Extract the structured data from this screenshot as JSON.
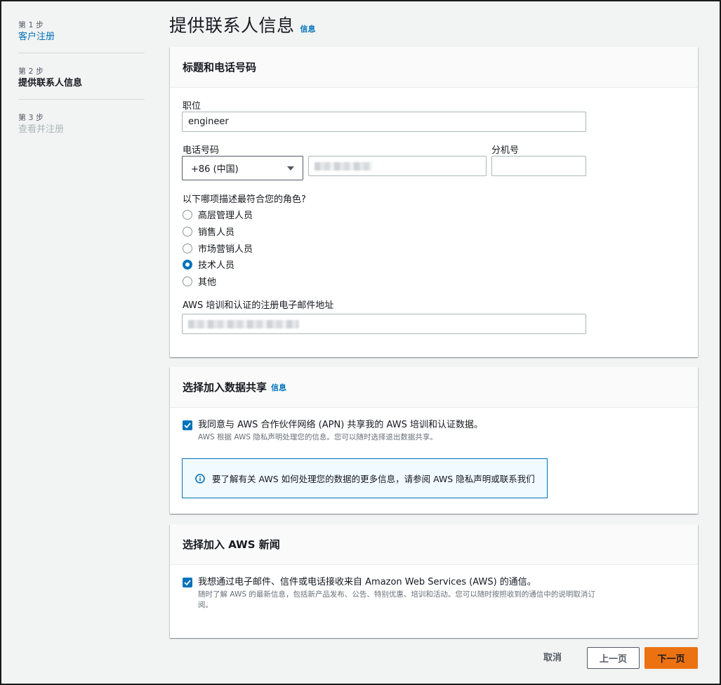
{
  "sidebar": {
    "steps": [
      {
        "number": "第 1 步",
        "label": "客户注册",
        "state": "link"
      },
      {
        "number": "第 2 步",
        "label": "提供联系人信息",
        "state": "active"
      },
      {
        "number": "第 3 步",
        "label": "查看并注册",
        "state": "disabled"
      }
    ]
  },
  "page": {
    "title": "提供联系人信息",
    "info_link": "信息"
  },
  "title_phone": {
    "header": "标题和电话号码",
    "job_title_label": "职位",
    "job_title_value": "engineer",
    "phone_label": "电话号码",
    "country_code": "+86 (中国)",
    "extension_label": "分机号",
    "extension_value": "",
    "role_question": "以下哪项描述最符合您的角色?",
    "roles": [
      {
        "label": "高层管理人员",
        "checked": false
      },
      {
        "label": "销售人员",
        "checked": false
      },
      {
        "label": "市场营销人员",
        "checked": false
      },
      {
        "label": "技术人员",
        "checked": true
      },
      {
        "label": "其他",
        "checked": false
      }
    ],
    "email_label": "AWS 培训和认证的注册电子邮件地址"
  },
  "data_sharing": {
    "header": "选择加入数据共享",
    "info_link": "信息",
    "consent_text": "我同意与 AWS 合作伙伴网络 (APN) 共享我的 AWS 培训和认证数据。",
    "consent_sub": "AWS 根据 AWS 隐私声明处理您的信息。您可以随时选择退出数据共享。",
    "consent_checked": true,
    "alert_text": "要了解有关 AWS 如何处理您的数据的更多信息，请参阅 AWS 隐私声明或联系我们"
  },
  "news": {
    "header": "选择加入 AWS 新闻",
    "consent_text": "我想通过电子邮件、信件或电话接收来自 Amazon Web Services (AWS) 的通信。",
    "consent_sub": "随时了解 AWS 的最新信息，包括新产品发布、公告、特别优惠、培训和活动。您可以随时按照收到的通信中的说明取消订阅。",
    "consent_checked": true
  },
  "footer": {
    "cancel": "取消",
    "previous": "上一页",
    "next": "下一页"
  },
  "colors": {
    "link": "#0073bb",
    "primary_button": "#ec7211",
    "background": "#f2f3f3"
  }
}
